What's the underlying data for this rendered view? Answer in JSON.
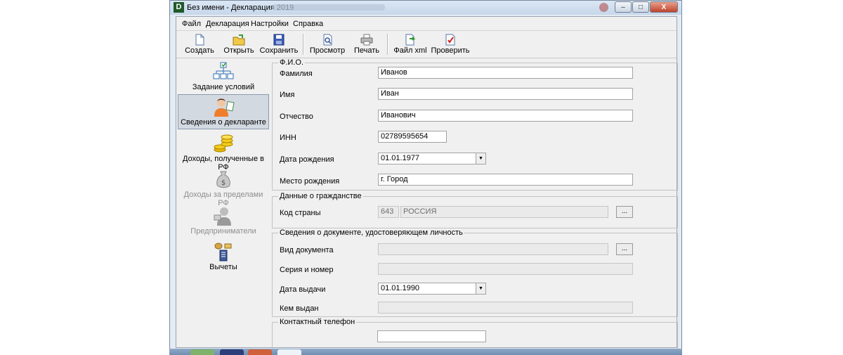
{
  "window": {
    "app_icon_letter": "D",
    "title": "Без имени - Декларация 2019",
    "buttons": {
      "minimize": "–",
      "maximize": "□",
      "close": "X"
    }
  },
  "menu": [
    "Файл",
    "Декларация",
    "Настройки",
    "Справка"
  ],
  "toolbar": [
    {
      "label": "Создать",
      "icon": "new-document-icon"
    },
    {
      "label": "Открыть",
      "icon": "open-folder-icon"
    },
    {
      "label": "Сохранить",
      "icon": "save-disk-icon"
    },
    {
      "label": "Просмотр",
      "icon": "preview-icon"
    },
    {
      "label": "Печать",
      "icon": "printer-icon"
    },
    {
      "label": "Файл xml",
      "icon": "xml-export-icon"
    },
    {
      "label": "Проверить",
      "icon": "check-icon"
    }
  ],
  "nav": [
    {
      "label": "Задание условий",
      "icon": "conditions-tree-icon",
      "state": "normal"
    },
    {
      "label": "Сведения о декларанте",
      "icon": "person-icon",
      "state": "selected"
    },
    {
      "label": "Доходы, полученные в РФ",
      "icon": "coins-icon",
      "state": "normal"
    },
    {
      "label": "Доходы за пределами РФ",
      "icon": "money-bag-icon",
      "state": "disabled"
    },
    {
      "label": "Предприниматели",
      "icon": "entrepreneur-icon",
      "state": "disabled"
    },
    {
      "label": "Вычеты",
      "icon": "deductions-icon",
      "state": "normal"
    }
  ],
  "fio": {
    "legend": "Ф.И.О.",
    "last_name_label": "Фамилия",
    "last_name": "Иванов",
    "first_name_label": "Имя",
    "first_name": "Иван",
    "patronymic_label": "Отчество",
    "patronymic": "Иванович",
    "inn_label": "ИНН",
    "inn": "02789595654",
    "birth_date_label": "Дата рождения",
    "birth_date": "01.01.1977",
    "birth_place_label": "Место рождения",
    "birth_place": "г. Город"
  },
  "citizenship": {
    "legend": "Данные о гражданстве",
    "country_code_label": "Код страны",
    "country_code": "643",
    "country_name": "РОССИЯ",
    "browse": "..."
  },
  "identity": {
    "legend": "Сведения о документе, удостоверяющем личность",
    "doc_type_label": "Вид документа",
    "doc_type": "",
    "browse": "...",
    "series_number_label": "Серия и номер",
    "series_number": "",
    "issue_date_label": "Дата выдачи",
    "issue_date": "01.01.1990",
    "issued_by_label": "Кем выдан",
    "issued_by": ""
  },
  "contact": {
    "legend": "Контактный телефон",
    "phone": ""
  }
}
